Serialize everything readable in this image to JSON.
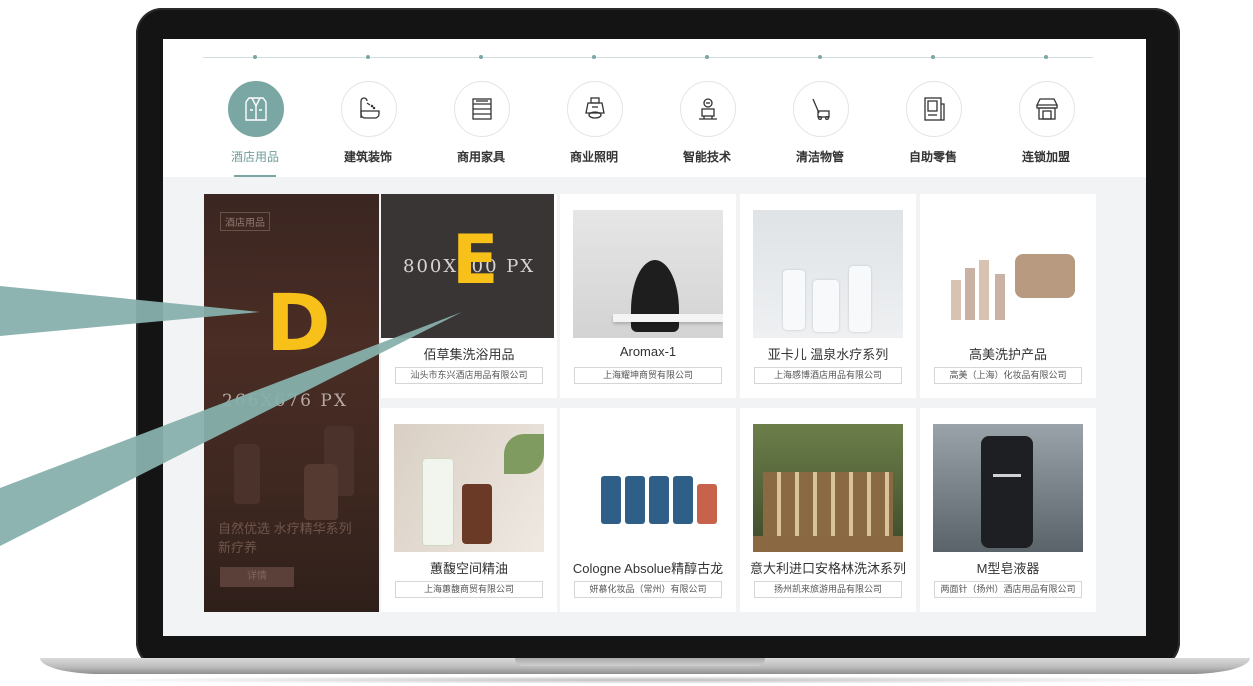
{
  "nav": {
    "items": [
      {
        "label": "酒店用品",
        "icon": "suit-icon",
        "active": true
      },
      {
        "label": "建筑装饰",
        "icon": "bathtub-icon",
        "active": false
      },
      {
        "label": "商用家具",
        "icon": "cabinet-icon",
        "active": false
      },
      {
        "label": "商业照明",
        "icon": "lamp-icon",
        "active": false
      },
      {
        "label": "智能技术",
        "icon": "robot-icon",
        "active": false
      },
      {
        "label": "清洁物管",
        "icon": "floor-cleaner-icon",
        "active": false
      },
      {
        "label": "自助零售",
        "icon": "vending-machine-icon",
        "active": false
      },
      {
        "label": "连锁加盟",
        "icon": "storefront-icon",
        "active": false
      }
    ]
  },
  "banner": {
    "tag": "酒店用品",
    "size_placeholder": "266X676 PX",
    "text": "自然优选 水疗精华系列 新疗养",
    "button": "详情"
  },
  "featured": {
    "size_placeholder": "800X400 PX",
    "title": "佰草集洗浴用品",
    "company": "汕头市东兴酒店用品有限公司"
  },
  "products": [
    {
      "title": "Aromax-1",
      "company": "上海耀坤商贸有限公司"
    },
    {
      "title": "亚卡儿 温泉水疗系列",
      "company": "上海感博酒店用品有限公司"
    },
    {
      "title": "高美洗护产品",
      "company": "高美（上海）化妆品有限公司"
    },
    {
      "title": "蕙馥空间精油",
      "company": "上海蕙馥商贸有限公司"
    },
    {
      "title": "Cologne Absolue精醇古龙",
      "company": "妍慕化妆品（常州）有限公司"
    },
    {
      "title": "意大利进口安格林洗沐系列",
      "company": "扬州凯来旅游用品有限公司"
    },
    {
      "title": "M型皂液器",
      "company": "两面针（扬州）酒店用品有限公司"
    }
  ],
  "annotations": {
    "label_d": "D",
    "label_e": "E"
  },
  "colors": {
    "accent": "#7aa6a3",
    "annotation_letter": "#f8c11a",
    "annotation_pointer": "#87b0ac",
    "banner_bg": "#3e2820"
  }
}
